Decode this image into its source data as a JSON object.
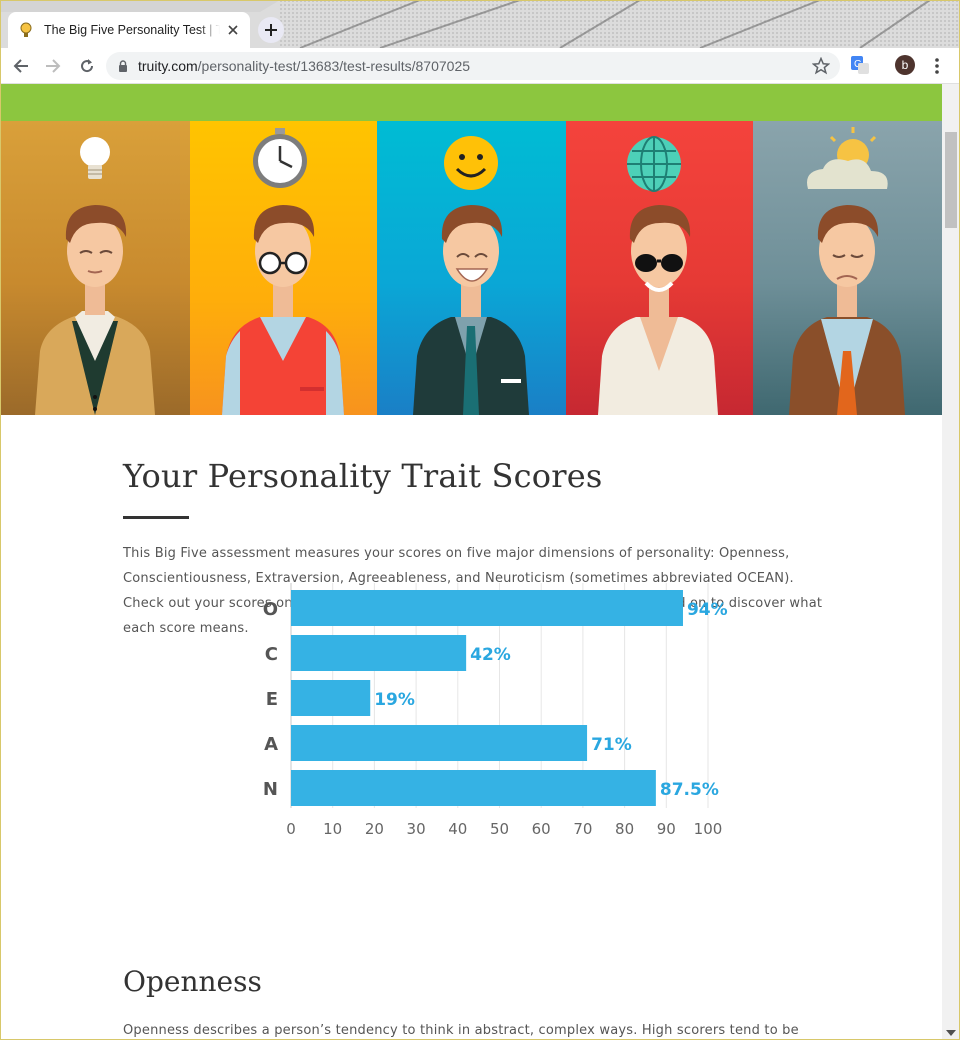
{
  "browser": {
    "tab_title": "The Big Five Personality Test | Truity",
    "url_host": "truity.com",
    "url_path": "/personality-test/13683/test-results/8707025",
    "profile_initial": "b"
  },
  "page": {
    "title": "Your Personality Trait Scores",
    "intro": "This Big Five assessment measures your scores on five major dimensions of personality: Openness, Conscientiousness, Extraversion, Agreeableness, and Neuroticism (sometimes abbreviated OCEAN). Check out your scores on each of the five dimensions in the graph below, then read on to discover what each score means.",
    "section_title": "Openness",
    "section_text": "Openness describes a person’s tendency to think in abstract, complex ways. High scorers tend to be"
  },
  "colors": {
    "accent_green": "#8cc63f",
    "bar_blue": "#35b2e4",
    "label_blue": "#2aa7e0"
  },
  "chart_data": {
    "type": "bar",
    "orientation": "horizontal",
    "categories": [
      "O",
      "C",
      "E",
      "A",
      "N"
    ],
    "values": [
      94,
      42,
      19,
      71,
      87.5
    ],
    "value_labels": [
      "94%",
      "42%",
      "19%",
      "71%",
      "87.5%"
    ],
    "xlim": [
      0,
      100
    ],
    "xticks": [
      "0",
      "10",
      "20",
      "30",
      "40",
      "50",
      "60",
      "70",
      "80",
      "90",
      "100"
    ],
    "grid": true
  }
}
